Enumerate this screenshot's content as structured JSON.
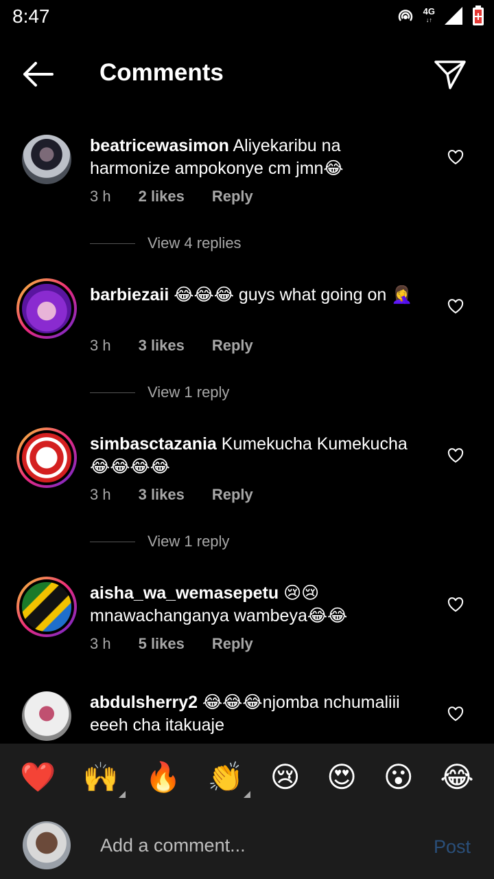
{
  "status": {
    "time": "8:47",
    "network": "4G"
  },
  "header": {
    "title": "Comments"
  },
  "comments": [
    {
      "user": "beatricewasimon",
      "text": "Aliyekaribu na harmonize ampokonye cm jmn😂",
      "time": "3 h",
      "likes": "2 likes",
      "reply": "Reply",
      "view_replies": "View 4 replies"
    },
    {
      "user": "barbiezaii",
      "text": "😂😂😂 guys what going on 🤦‍♀️",
      "time": "3 h",
      "likes": "3 likes",
      "reply": "Reply",
      "view_replies": "View 1 reply"
    },
    {
      "user": "simbasctazania",
      "text": "Kumekucha Kumekucha 😂😂😂😂",
      "time": "3 h",
      "likes": "3 likes",
      "reply": "Reply",
      "view_replies": "View 1 reply"
    },
    {
      "user": "aisha_wa_wemasepetu",
      "text": "😢😢 mnawachanganya wambeya😂😂",
      "time": "3 h",
      "likes": "5 likes",
      "reply": "Reply"
    },
    {
      "user": "abdulsherry2",
      "text": "😂😂😂njomba nchumaliii eeeh cha itakuaje"
    }
  ],
  "reactions": [
    "❤️",
    "🙌",
    "🔥",
    "👏",
    "😢",
    "😍",
    "😮",
    "😂"
  ],
  "composer": {
    "placeholder": "Add a comment...",
    "post_label": "Post"
  }
}
